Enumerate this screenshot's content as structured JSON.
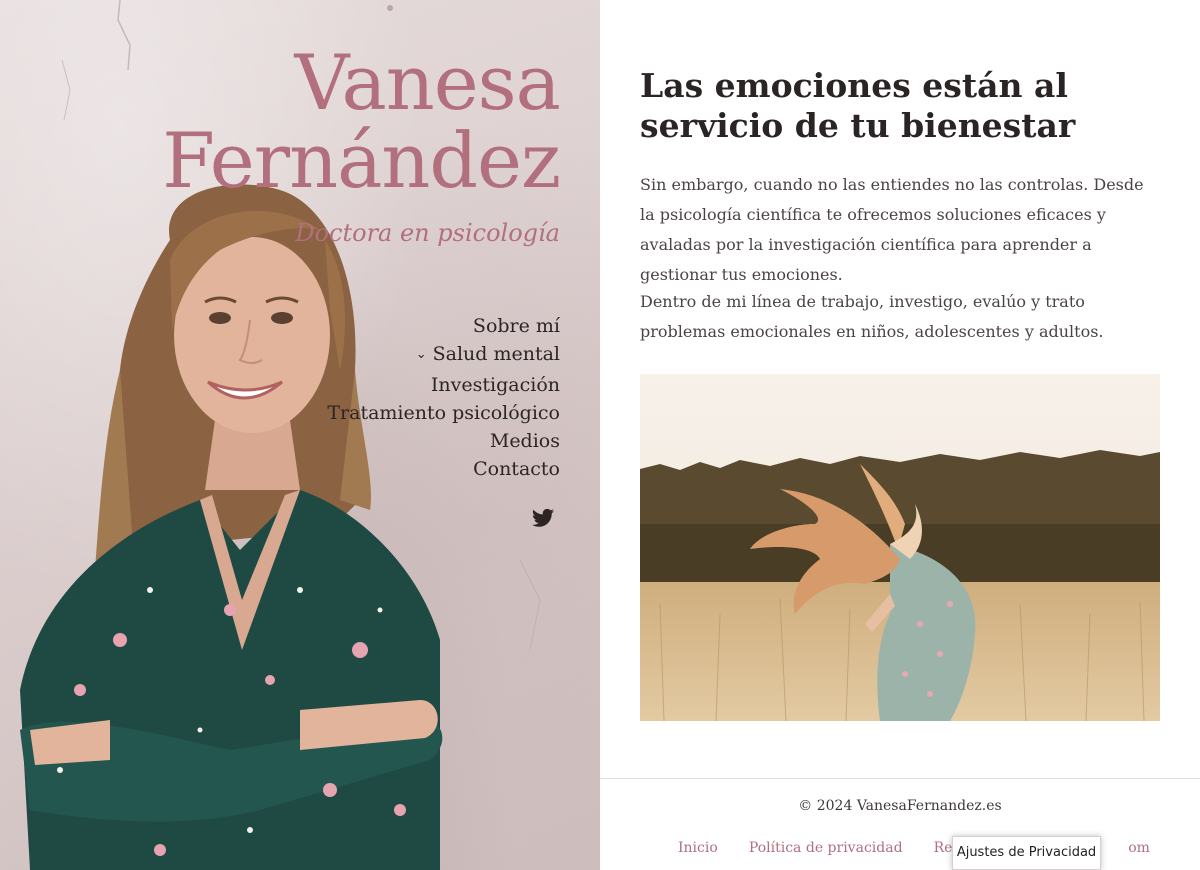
{
  "brand": {
    "name_line1": "Vanesa",
    "name_line2": "Fernández",
    "tagline": "Doctora en psicología"
  },
  "nav": {
    "items": [
      {
        "label": "Sobre mí"
      },
      {
        "label": "Salud mental",
        "icon": "chevron-down-icon"
      },
      {
        "label": "Investigación"
      },
      {
        "label": "Tratamiento psicológico"
      },
      {
        "label": "Medios"
      },
      {
        "label": "Contacto"
      }
    ]
  },
  "social": {
    "icon": "twitter-icon"
  },
  "main": {
    "headline": "Las emociones están al servicio de tu bienestar",
    "paragraph1": "Sin embargo, cuando no las entiendes no las controlas. Desde la psicología científica te ofrecemos soluciones eficaces y avaladas por la investigación científica para aprender a gestionar tus emociones.",
    "paragraph2": "Dentro de mi línea de trabajo, investigo, evalúo y trato problemas emocionales en niños, adolescentes y adultos."
  },
  "footer": {
    "copyright": "© 2024 VanesaFernandez.es",
    "links": [
      "Inicio",
      "Política de privacidad",
      "Realiz",
      "om"
    ],
    "privacy_settings": "Ajustes de Privacidad"
  },
  "colors": {
    "accent": "#b26f7d",
    "text": "#2a2424",
    "body_text": "#4c4444"
  }
}
